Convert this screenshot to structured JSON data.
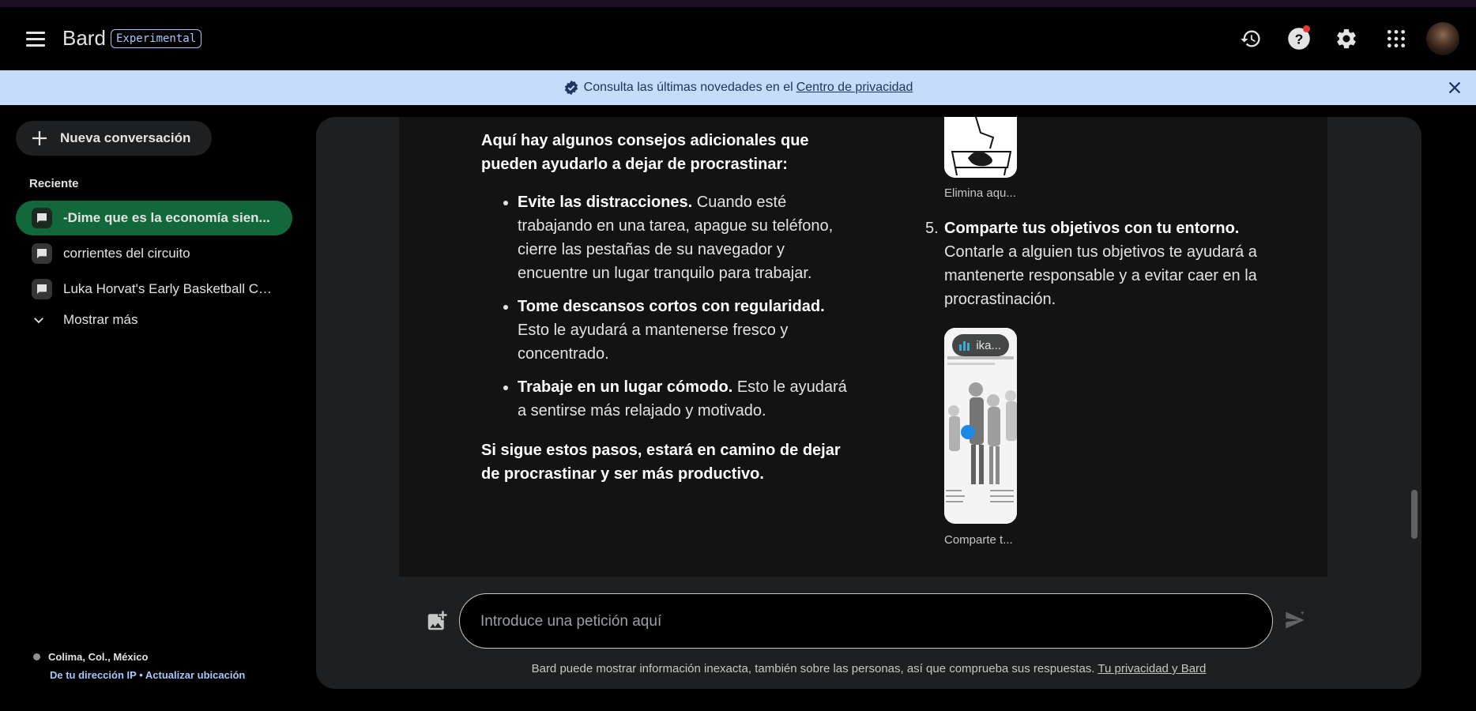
{
  "header": {
    "brand": "Bard",
    "badge": "Experimental",
    "icons": [
      "menu-icon",
      "history-icon",
      "help-icon",
      "settings-icon",
      "apps-icon",
      "avatar"
    ]
  },
  "banner": {
    "text": "Consulta las últimas novedades en el",
    "link": "Centro de privacidad"
  },
  "sidebar": {
    "new_chat": "Nueva conversación",
    "recent_title": "Reciente",
    "chats": [
      {
        "title": "-Dime que es la economía sien..."
      },
      {
        "title": "corrientes del circuito"
      },
      {
        "title": "Luka Horvat's Early Basketball Ca..."
      }
    ],
    "show_more": "Mostrar más",
    "location": {
      "place": "Colima, Col., México",
      "ip_link": "De tu dirección IP",
      "separator": "•",
      "update_link": "Actualizar ubicación"
    }
  },
  "answer": {
    "intro": "Aquí hay algunos consejos adicionales que pueden ayudarlo a dejar de procrastinar:",
    "tips": [
      {
        "bold": "Evite las distracciones.",
        "text": " Cuando esté trabajando en una tarea, apague su teléfono, cierre las pestañas de su navegador y encuentre un lugar tranquilo para trabajar."
      },
      {
        "bold": "Tome descansos cortos con regularidad.",
        "text": " Esto le ayudará a mantenerse fresco y concentrado."
      },
      {
        "bold": "Trabaje en un lugar cómodo.",
        "text": " Esto le ayudará a sentirse más relajado y motivado."
      }
    ],
    "conclusion": "Si sigue estos pasos, estará en camino de dejar de procrastinar y ser más productivo.",
    "image_caption_top": "Elimina aqu...",
    "item5": {
      "number": "5.",
      "bold": "Comparte tus objetivos con tu entorno.",
      "text": " Contarle a alguien tus objetivos te ayudará a mantenerte responsable y a evitar caer en la procrastinación."
    },
    "image_chip": "ika...",
    "image_caption_bottom": "Comparte t..."
  },
  "composer": {
    "placeholder": "Introduce una petición aquí",
    "disclaimer": "Bard puede mostrar información inexacta, también sobre las personas, así que comprueba sus respuestas.",
    "disclaimer_link": "Tu privacidad y Bard"
  },
  "colors": {
    "accent_blue": "#a8c7fa",
    "banner_bg": "#c5dcfb",
    "active_chat": "#12683a",
    "surface": "#1e1f20"
  }
}
